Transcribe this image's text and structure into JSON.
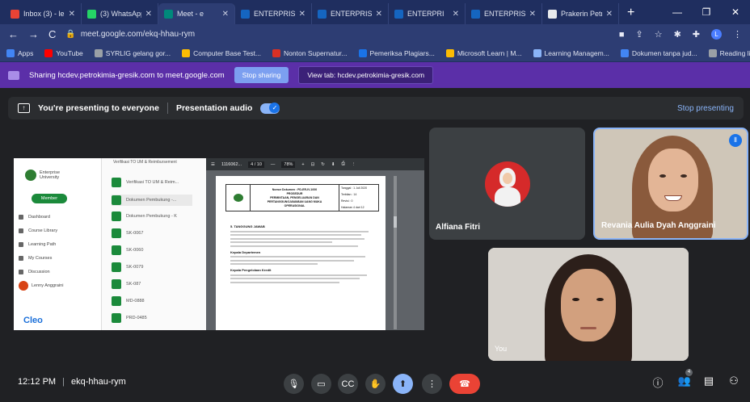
{
  "tabs": [
    {
      "label": "Inbox (3) - le",
      "color": "#ea4335",
      "active": false
    },
    {
      "label": "(3) WhatsApp",
      "color": "#25d366",
      "active": false
    },
    {
      "label": "Meet - e",
      "color": "#00897b",
      "active": true
    },
    {
      "label": "ENTERPRISE -",
      "color": "#1565c0",
      "active": false
    },
    {
      "label": "ENTERPRISE -",
      "color": "#1565c0",
      "active": false
    },
    {
      "label": "ENTERPRI",
      "color": "#1565c0",
      "active": false
    },
    {
      "label": "ENTERPRISE -",
      "color": "#1565c0",
      "active": false
    },
    {
      "label": "Prakerin Petr",
      "color": "#e8eaed",
      "active": false
    }
  ],
  "address": {
    "url": "meet.google.com/ekq-hhau-rym",
    "profile_initial": "L"
  },
  "bookmarks": [
    {
      "label": "Apps",
      "color": "#4285f4"
    },
    {
      "label": "YouTube",
      "color": "#ff0000"
    },
    {
      "label": "SYRLIG gelang gor...",
      "color": "#9aa0a6"
    },
    {
      "label": "Computer Base Test...",
      "color": "#fbbc04"
    },
    {
      "label": "Nonton Supernatur...",
      "color": "#d93025"
    },
    {
      "label": "Pemeriksa Plagiars...",
      "color": "#1a73e8"
    },
    {
      "label": "Microsoft Learn | M...",
      "color": "#fbbc04"
    },
    {
      "label": "Learning Managem...",
      "color": "#8ab4f8"
    },
    {
      "label": "Dokumen tanpa jud...",
      "color": "#4285f4"
    }
  ],
  "reading_list": "Reading list",
  "sharebar": {
    "message": "Sharing hcdev.petrokimia-gresik.com to meet.google.com",
    "stop_label": "Stop sharing",
    "view_label": "View tab: hcdev.petrokimia-gresik.com"
  },
  "presenting": {
    "text": "You're presenting to everyone",
    "audio_label": "Presentation audio",
    "audio_on": true,
    "stop_label": "Stop presenting"
  },
  "shared": {
    "lms_brand": "Enterprise University",
    "member_label": "Member",
    "menu": [
      "Dashboard",
      "Course Library",
      "Learning Path",
      "My Courses",
      "Discussion"
    ],
    "user": "Lenny Anggraini",
    "cleo": "Cleo",
    "list_header": "Verifikasi TO UM & Reimbursement",
    "list_items": [
      "Verifikasi TO UM & Reim...",
      "Dokumen Pembukung -...",
      "Dokumen Pembukung - K",
      "SK-0067",
      "SK-0060",
      "SK-0079",
      "SK-087",
      "MD-0888",
      "PRD-0485"
    ],
    "pdf_name": "1116062...",
    "pdf_page": "4 / 10",
    "pdf_zoom": "78%",
    "doc_label": "Nomor Dokumen : PD-ER-IV-1000",
    "doc_title_1": "PROSEDUR",
    "doc_title_2": "PERMINTAAN, PENGELUARAN DAN",
    "doc_title_3": "PERTANGGUNGJAWABAN UANG MUKA",
    "doc_title_4": "OPERASIONAL",
    "doc_date": "Tanggal : 1 Juli 2020",
    "doc_edition": "Terbitan : 14",
    "doc_rev": "Revisi : 0",
    "doc_page": "Halaman 4 dari 12",
    "section_1": "5. TANGGUNG JAWAB",
    "sub_a": "Kepala Departemen",
    "sub_b": "Kepala Pengelolaan Kredit"
  },
  "participants": [
    {
      "name": "Alfiana Fitri"
    },
    {
      "name": "Revania Aulia Dyah Anggraini"
    },
    {
      "name": "You"
    }
  ],
  "bottom": {
    "time": "12:12 PM",
    "separator": "|",
    "code": "ekq-hhau-rym",
    "participant_count": "4"
  }
}
